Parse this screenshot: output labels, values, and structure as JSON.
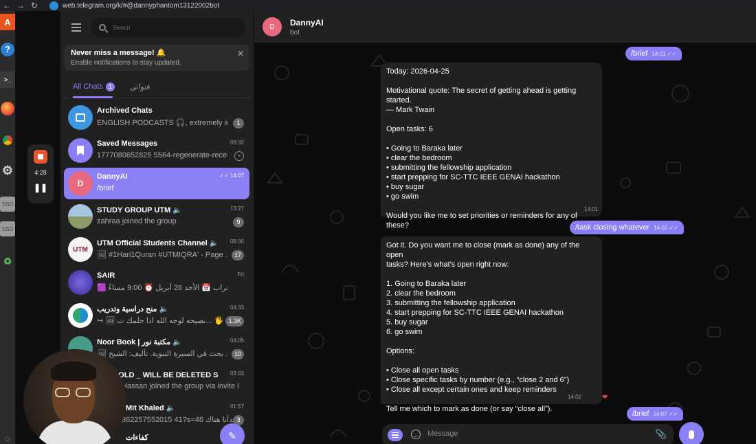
{
  "browser": {
    "url": "web.telegram.org/k/#@dannyphantom13122002bot",
    "back_glyph": "←",
    "forward_glyph": "→",
    "reload_glyph": "↻"
  },
  "dock": {
    "icons": [
      "app-store-icon",
      "help-icon",
      "terminal-icon",
      "firefox-icon",
      "chrome-icon",
      "settings-icon"
    ],
    "ssd_label": "SSD"
  },
  "recorder": {
    "time": "4:28",
    "pause_glyph": "❚❚"
  },
  "sidebar": {
    "search_placeholder": "Search",
    "notification": {
      "title": "Never miss a message! 🔔",
      "subtitle": "Enable notifications to stay updated.",
      "close_glyph": "✕"
    },
    "tabs": [
      {
        "label": "All Chats",
        "badge": "1"
      },
      {
        "label": "قنواتي"
      }
    ],
    "chats": [
      {
        "name": "Archived Chats",
        "preview": "ENGLISH PODCASTS 🎧, extremely im...",
        "time": "",
        "badge": "1",
        "avatar_letter": "",
        "avatar_color": "#3f96e0"
      },
      {
        "name": "Saved Messages",
        "preview": "1777080652825 5564-regenerate-receip...",
        "time": "09:32",
        "badge": "",
        "avatar_letter": "",
        "avatar_color": "#8b7ff5",
        "pinned": true
      },
      {
        "name": "DannyAI",
        "preview": "/brief",
        "time": "✓✓ 14:07",
        "badge": "",
        "avatar_letter": "D",
        "avatar_color": "#e96a7e",
        "selected": true
      },
      {
        "name": "STUDY GROUP UTM 🔈",
        "preview": "zahraa joined the group",
        "time": "13:27",
        "badge": "9",
        "avatar_letter": "",
        "avatar_color": "#a3b08a"
      },
      {
        "name": "UTM Official Students Channel 🔈",
        "preview": "🖼 #1Hari1Quran #UTMIQRA' - Page ...",
        "time": "08:30",
        "badge": "17",
        "avatar_letter": "UTM",
        "avatar_color": "#f4f4f4"
      },
      {
        "name": "SAIR",
        "preview": "🟪 خليكم قراب 📅 الأحد 26 أبريل ⏰ 9:00 مساءً...",
        "time": "Fri",
        "badge": "",
        "avatar_letter": "",
        "avatar_color": "#4a3aa8"
      },
      {
        "name": "منح دراسية وتدريب 🔈",
        "preview": "↪ 🖼 نصيحه لوجه الله اذا حلمك ت... 🖐🧯",
        "time": "04:33",
        "badge": "1.3K",
        "avatar_letter": "",
        "avatar_color": "#ffffff"
      },
      {
        "name": "Noor Book | مكتبة نور 🔈",
        "preview": "🖼 بحث في السيرة النبوية. تأليف: الشيخ ...",
        "time": "04:05",
        "badge": "10",
        "avatar_letter": "",
        "avatar_color": "#4a9c8a"
      },
      {
        "name": "...OLD _ WILL BE DELETED SOON 🔈",
        "preview": "Hassan joined the group via invite li...",
        "time": "02:03",
        "badge": "",
        "avatar_letter": "",
        "avatar_color": "#555555"
      },
      {
        "name": "Mit Khaled 🔈",
        "preview": "362257552015 41?s=46 بدأنا هناك",
        "time": "01:57",
        "badge": "3",
        "avatar_letter": "",
        "avatar_color": "#555555"
      },
      {
        "name": "كفاءات",
        "preview": "",
        "time": "",
        "badge": "",
        "avatar_letter": "",
        "avatar_color": "#555555"
      }
    ],
    "compose_glyph": "✎"
  },
  "chat": {
    "header": {
      "name": "DannyAI",
      "status": "bot",
      "avatar_letter": "D"
    },
    "messages": [
      {
        "dir": "out",
        "text": "/brief",
        "time": "14:01",
        "ticks": "✓✓"
      },
      {
        "dir": "in",
        "text": "Today: 2026-04-25\n\nMotivational quote: The secret of getting ahead is getting started.\n— Mark Twain\n\nOpen tasks: 6\n\n• Going to Baraka later\n• clear the bedroom\n• submitting the fellowship application\n• start prepping for SC-TTC IEEE GENAI hackathon\n• buy sugar\n• go swim\n\nWould you like me to set priorities or reminders for any of these?",
        "time": "14:01"
      },
      {
        "dir": "out",
        "text": "/task closing whatever",
        "time": "14:02",
        "ticks": "✓✓"
      },
      {
        "dir": "in",
        "text": "Got it. Do you want me to close (mark as done) any of the open\ntasks? Here's what's open right now:\n\n1. Going to Baraka later\n2. clear the bedroom\n3. submitting the fellowship application\n4. start prepping for SC-TTC IEEE GENAI hackathon\n5. buy sugar\n6. go swim\n\nOptions:\n\n• Close all open tasks\n• Close specific tasks by number (e.g., “close 2 and 6”)\n• Close all except certain ones and keep reminders\n\nTell me which to mark as done (or say “close all”).",
        "time": "14:02",
        "reaction": "❤"
      },
      {
        "dir": "out",
        "text": "/brief",
        "time": "14:07",
        "ticks": "✓✓"
      }
    ],
    "composer": {
      "placeholder": "Message",
      "attach_glyph": "📎"
    }
  }
}
